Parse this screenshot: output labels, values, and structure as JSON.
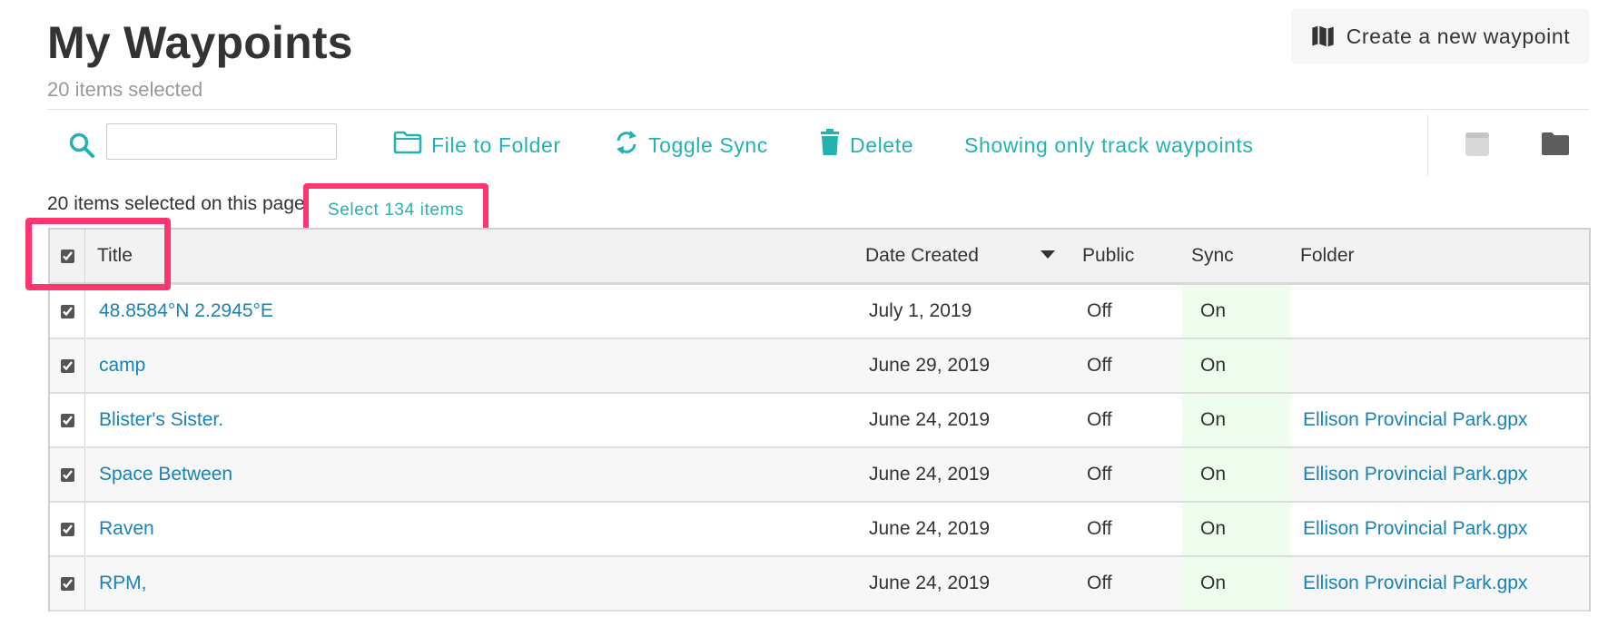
{
  "header": {
    "title": "My Waypoints",
    "subtitle": "20 items selected",
    "create_button": "Create a new waypoint"
  },
  "toolbar": {
    "search_placeholder": "",
    "file_to_folder": "File to Folder",
    "toggle_sync": "Toggle Sync",
    "delete": "Delete",
    "filter_status": "Showing only track waypoints"
  },
  "selection": {
    "note": "20 items selected on this page",
    "select_all_button": "Select 134 items"
  },
  "table": {
    "columns": {
      "title": "Title",
      "date_created": "Date Created",
      "public": "Public",
      "sync": "Sync",
      "folder": "Folder"
    },
    "rows": [
      {
        "title": "48.8584°N 2.2945°E",
        "date": "July 1, 2019",
        "public": "Off",
        "sync": "On",
        "folder": ""
      },
      {
        "title": "camp",
        "date": "June 29, 2019",
        "public": "Off",
        "sync": "On",
        "folder": ""
      },
      {
        "title": "Blister's Sister.",
        "date": "June 24, 2019",
        "public": "Off",
        "sync": "On",
        "folder": "Ellison Provincial Park.gpx"
      },
      {
        "title": "Space Between",
        "date": "June 24, 2019",
        "public": "Off",
        "sync": "On",
        "folder": "Ellison Provincial Park.gpx"
      },
      {
        "title": "Raven",
        "date": "June 24, 2019",
        "public": "Off",
        "sync": "On",
        "folder": "Ellison Provincial Park.gpx"
      },
      {
        "title": "RPM,",
        "date": "June 24, 2019",
        "public": "Off",
        "sync": "On",
        "folder": "Ellison Provincial Park.gpx"
      }
    ]
  },
  "colors": {
    "accent": "#26b1b1",
    "link": "#1a82b4",
    "highlight": "#ff3571",
    "sync_on_bg": "#effdef"
  }
}
